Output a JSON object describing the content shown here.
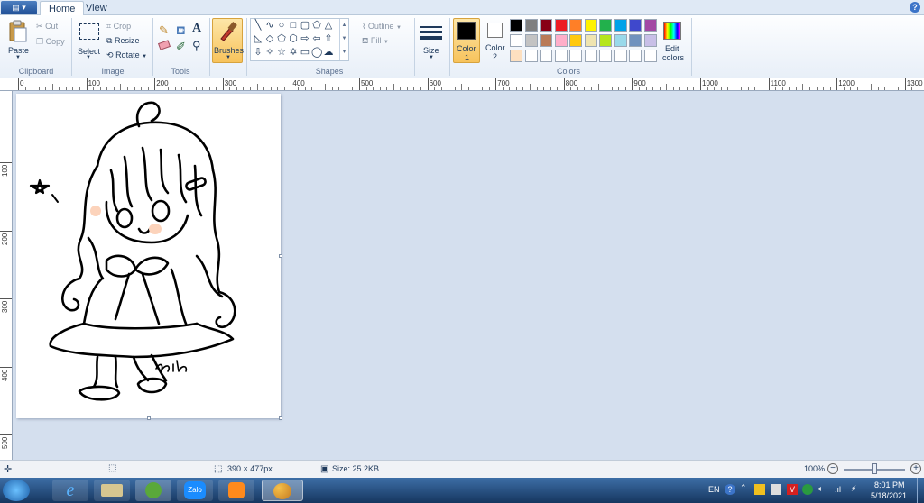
{
  "tabs": {
    "menu_label": "▤ ▾",
    "home": "Home",
    "view": "View"
  },
  "clipboard": {
    "paste": "Paste",
    "cut": "Cut",
    "copy": "Copy",
    "label": "Clipboard"
  },
  "image": {
    "select": "Select",
    "crop": "Crop",
    "resize": "Resize",
    "rotate": "Rotate",
    "label": "Image"
  },
  "tools": {
    "label": "Tools"
  },
  "brushes": {
    "label": "Brushes"
  },
  "shapes": {
    "outline": "Outline",
    "fill": "Fill",
    "label": "Shapes"
  },
  "size": {
    "label": "Size"
  },
  "colors": {
    "color1": "Color",
    "color1_num": "1",
    "color2": "Color",
    "color2_num": "2",
    "edit": "Edit",
    "edit2": "colors",
    "label": "Colors",
    "row1": [
      "#000000",
      "#7f7f7f",
      "#880015",
      "#ed1c24",
      "#ff7f27",
      "#fff200",
      "#22b14c",
      "#00a2e8",
      "#3f48cc",
      "#a349a4"
    ],
    "row2": [
      "#ffffff",
      "#c3c3c3",
      "#b97a57",
      "#ffaec9",
      "#ffc90e",
      "#efe4b0",
      "#b5e61d",
      "#99d9ea",
      "#7092be",
      "#c8bfe7"
    ],
    "row3": [
      "#fde0c0",
      "#ffffff",
      "#ffffff",
      "#ffffff",
      "#ffffff",
      "#ffffff",
      "#ffffff",
      "#ffffff",
      "#ffffff",
      "#ffffff"
    ]
  },
  "ruler": {
    "h": [
      "0",
      "100",
      "200",
      "300",
      "400",
      "500",
      "600",
      "700",
      "800",
      "900",
      "1000",
      "1100",
      "1200",
      "1300"
    ],
    "v": [
      "100",
      "200",
      "300",
      "400",
      "500"
    ]
  },
  "status": {
    "dimensions": "390 × 477px",
    "size": "Size: 25.2KB",
    "zoom": "100%"
  },
  "taskbar": {
    "lang": "EN",
    "time": "8:01 PM",
    "date": "5/18/2021",
    "zalo": "Zalo"
  }
}
